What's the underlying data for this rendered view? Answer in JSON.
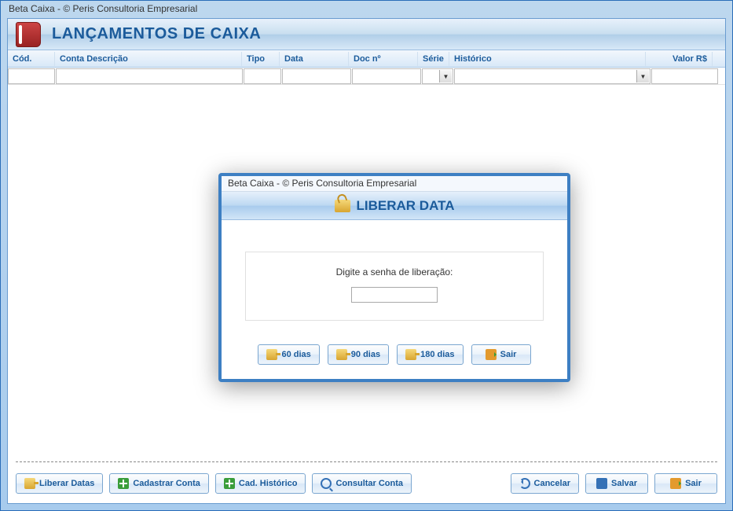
{
  "window": {
    "title": "Beta Caixa - © Peris Consultoria Empresarial"
  },
  "page": {
    "heading": "LANÇAMENTOS DE CAIXA"
  },
  "grid": {
    "headers": {
      "cod": "Cód.",
      "desc": "Conta Descrição",
      "tipo": "Tipo",
      "data": "Data",
      "doc": "Doc nº",
      "serie": "Série",
      "hist": "Histórico",
      "valor": "Valor R$"
    },
    "row": {
      "cod": "",
      "desc": "",
      "tipo": "",
      "data": "",
      "doc": "",
      "serie": "",
      "hist": "",
      "valor": ""
    }
  },
  "buttons": {
    "liberar_datas": "Liberar Datas",
    "cadastrar_conta": "Cadastrar Conta",
    "cad_historico": "Cad. Histórico",
    "consultar_conta": "Consultar Conta",
    "cancelar": "Cancelar",
    "salvar": "Salvar",
    "sair": "Sair"
  },
  "modal": {
    "titlebar": "Beta Caixa - © Peris Consultoria Empresarial",
    "heading": "LIBERAR DATA",
    "prompt": "Digite a senha de liberação:",
    "password_value": "",
    "buttons": {
      "d60": "60 dias",
      "d90": "90 dias",
      "d180": "180 dias",
      "sair": "Sair"
    }
  }
}
